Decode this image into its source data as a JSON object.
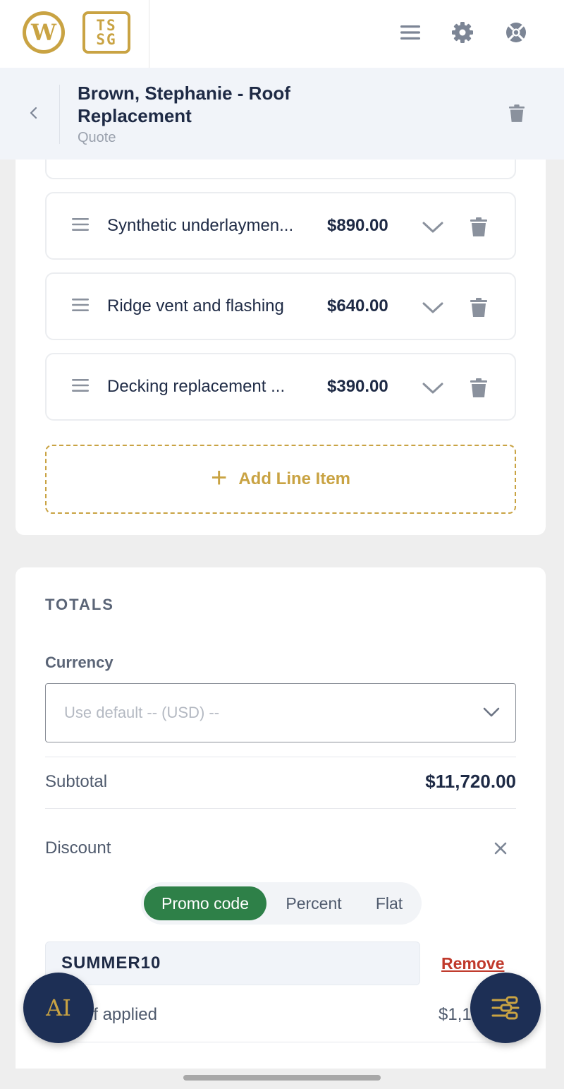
{
  "topbar": {
    "logo_wp_letter": "W",
    "logo_tssg_line1": "TS",
    "logo_tssg_line2": "SG",
    "icons": [
      "menu-icon",
      "gear-icon",
      "help-lifebuoy-icon"
    ]
  },
  "header": {
    "title": "Brown, Stephanie - Roof Replacement",
    "subtitle": "Quote"
  },
  "line_items": [
    {
      "name": "Synthetic underlaymen...",
      "price": "$890.00"
    },
    {
      "name": "Ridge vent and flashing",
      "price": "$640.00"
    },
    {
      "name": "Decking replacement ...",
      "price": "$390.00"
    }
  ],
  "add_line_item": {
    "label": "Add Line Item",
    "plus": "+"
  },
  "totals": {
    "heading": "TOTALS",
    "currency_label": "Currency",
    "currency_placeholder": "Use default -- (USD) --",
    "subtotal_label": "Subtotal",
    "subtotal_value": "$11,720.00",
    "discount_label": "Discount",
    "discount_tabs": [
      "Promo code",
      "Percent",
      "Flat"
    ],
    "discount_active_tab": "Promo code",
    "promo_code": "SUMMER10",
    "remove_label": "Remove",
    "applied_label": "ff applied",
    "applied_value": "$1,17"
  },
  "fab": {
    "ai_label": "AI"
  },
  "colors": {
    "accent_gold": "#c9a343",
    "navy": "#1d2f55",
    "active_green": "#2e8048",
    "danger_red": "#c0392b"
  }
}
